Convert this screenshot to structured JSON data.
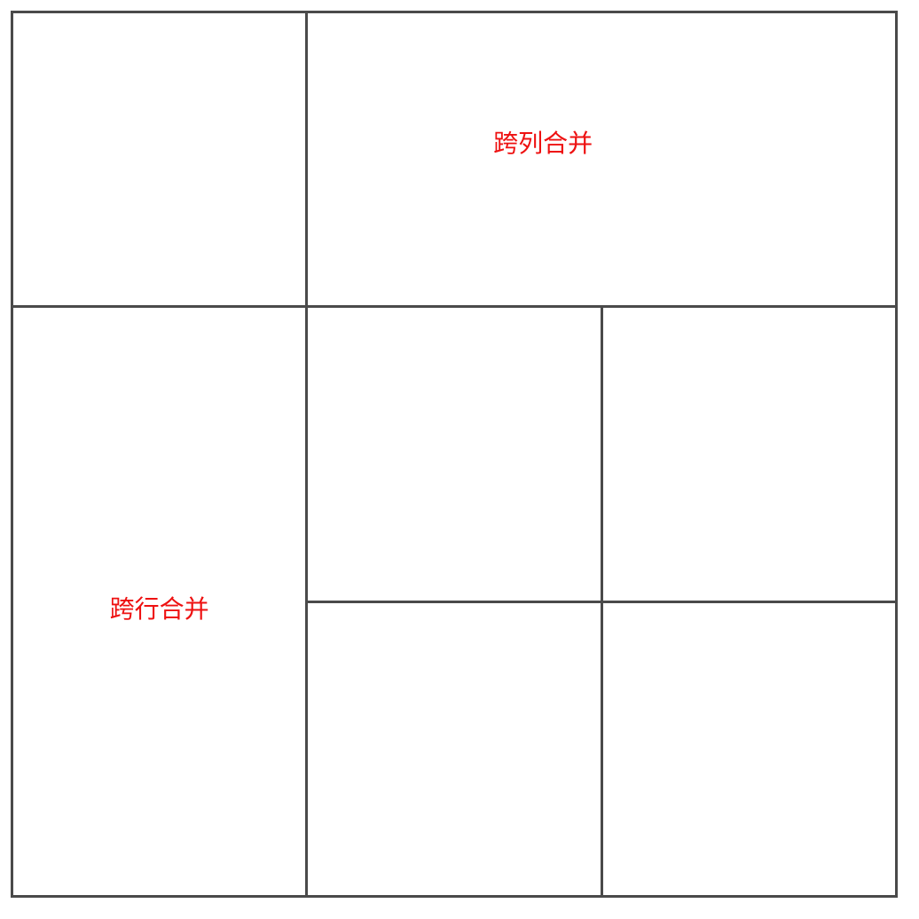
{
  "table": {
    "colspan_cell": {
      "text": "跨列合并"
    },
    "rowspan_cell": {
      "text": "跨行合并"
    }
  },
  "colors": {
    "border": "#4a4a4a",
    "text": "#ee1111",
    "background": "#ffffff"
  }
}
